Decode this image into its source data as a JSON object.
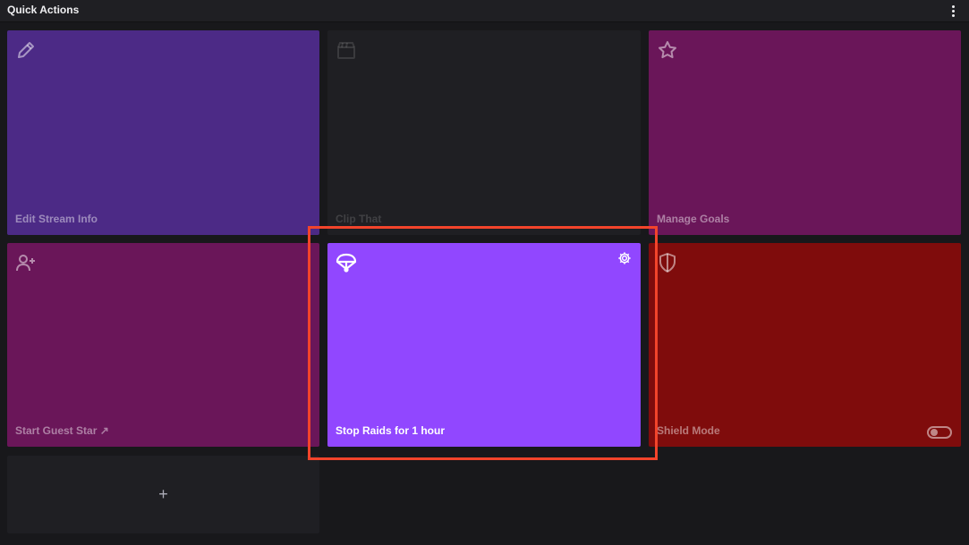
{
  "header": {
    "title": "Quick Actions",
    "menu_icon": "more-vertical-icon"
  },
  "tiles": [
    {
      "label": "Edit Stream Info",
      "icon": "pencil-icon",
      "color": "#4c2a86"
    },
    {
      "label": "Clip That",
      "icon": "clapperboard-icon",
      "color": "#1f1f23",
      "disabled": true
    },
    {
      "label": "Manage Goals",
      "icon": "star-icon",
      "color": "#6a1659"
    },
    {
      "label": "Start Guest Star ↗",
      "icon": "add-user-icon",
      "color": "#6a1659"
    },
    {
      "label": "Stop Raids for 1 hour",
      "icon": "parachute-icon",
      "color": "#9147ff",
      "active": true,
      "settings_icon": "gear-icon"
    },
    {
      "label": "Shield Mode",
      "icon": "shield-icon",
      "color": "#7f0c0c",
      "toggle_on": false
    }
  ],
  "add_tile": {
    "label": "+"
  },
  "colors": {
    "background": "#18181b",
    "highlight": "#f2442b"
  }
}
